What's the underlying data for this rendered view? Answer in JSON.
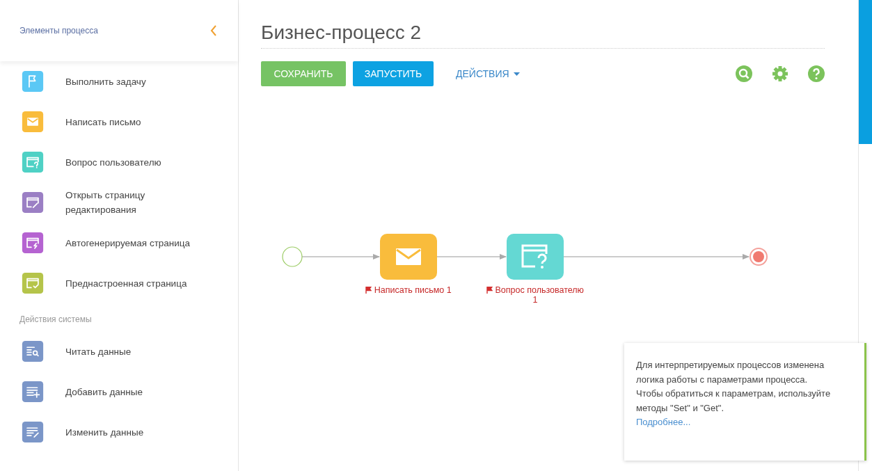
{
  "sidebar": {
    "title": "Элементы процесса",
    "items": [
      {
        "kind": "item",
        "label": "Выполнить задачу",
        "color": "#5bc8f5"
      },
      {
        "kind": "item",
        "label": "Написать письмо",
        "color": "#f9bc3c"
      },
      {
        "kind": "item",
        "label": "Вопрос пользователю",
        "color": "#4fd1c5"
      },
      {
        "kind": "item",
        "label": "Открыть страницу редактирования",
        "color": "#9b7fc4"
      },
      {
        "kind": "item",
        "label": "Автогенерируемая страница",
        "color": "#b563d1"
      },
      {
        "kind": "item",
        "label": "Преднастроенная страница",
        "color": "#b5c44a"
      },
      {
        "kind": "section",
        "label": "Действия системы"
      },
      {
        "kind": "item",
        "label": "Читать данные",
        "color": "#7b96c8"
      },
      {
        "kind": "item",
        "label": "Добавить данные",
        "color": "#7b96c8"
      },
      {
        "kind": "item",
        "label": "Изменить данные",
        "color": "#7b96c8"
      }
    ]
  },
  "title": "Бизнес-процесс 2",
  "toolbar": {
    "buttons": [
      {
        "kind": "save",
        "label": "СОХРАНИТЬ"
      },
      {
        "kind": "run",
        "label": "ЗАПУСТИТЬ"
      }
    ],
    "menu": "ДЕЙСТВИЯ"
  },
  "diagram": {
    "nodes": [
      {
        "kind": "start"
      },
      {
        "kind": "email",
        "label": "Написать письмо 1"
      },
      {
        "kind": "question",
        "label": "Вопрос пользователю 1"
      },
      {
        "kind": "end"
      }
    ]
  },
  "notice": {
    "text": "Для интерпретируемых процессов изменена логика работы с параметрами процесса. Чтобы обратиться к параметрам, используйте методы \"Set\" и \"Get\".",
    "link": "Подробнее..."
  }
}
